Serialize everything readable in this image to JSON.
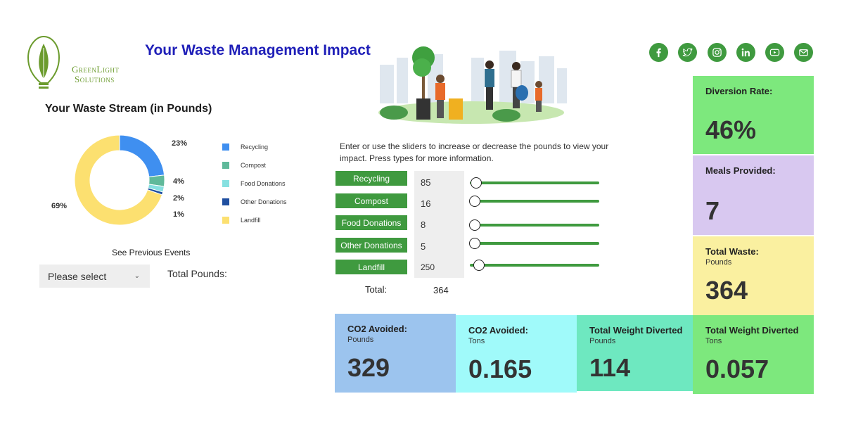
{
  "logo": {
    "line1": "GreenLight",
    "line2": "Solutions"
  },
  "title": "Your Waste Management Impact",
  "chart": {
    "title": "Your Waste Stream (in Pounds)"
  },
  "chart_data": {
    "type": "pie",
    "categories": [
      "Recycling",
      "Compost",
      "Food Donations",
      "Other Donations",
      "Landfill"
    ],
    "values": [
      23,
      4,
      2,
      1,
      69
    ],
    "labels": [
      "23%",
      "4%",
      "2%",
      "1%",
      "69%"
    ],
    "colors": [
      "#3f8ff0",
      "#5fb99a",
      "#86e0e0",
      "#1f4fa0",
      "#fce070"
    ],
    "legend_position": "right"
  },
  "events": {
    "label": "See Previous Events",
    "select_placeholder": "Please select",
    "total_pounds_label": "Total Pounds:"
  },
  "instructions": "Enter or use the sliders to increase or decrease the pounds to view your impact. Press types for more information.",
  "inputs": [
    {
      "label": "Recycling",
      "value": "85",
      "slider_fraction": 0.03
    },
    {
      "label": "Compost",
      "value": "16",
      "slider_fraction": 0.02
    },
    {
      "label": "Food Donations",
      "value": "8",
      "slider_fraction": 0.02
    },
    {
      "label": "Other Donations",
      "value": "5",
      "slider_fraction": 0.02
    },
    {
      "label": "Landfill",
      "value": "250",
      "slider_fraction": 0.05
    }
  ],
  "total": {
    "label": "Total:",
    "value": "364"
  },
  "social": [
    "facebook-icon",
    "twitter-icon",
    "instagram-icon",
    "linkedin-icon",
    "youtube-icon",
    "email-icon"
  ],
  "cards": {
    "diversion": {
      "title": "Diversion Rate:",
      "value": "46%",
      "color": "#7de87d"
    },
    "meals": {
      "title": "Meals Provided:",
      "value": "7",
      "color": "#d8c8f0"
    },
    "total_waste": {
      "title": "Total Waste:",
      "sub": "Pounds",
      "value": "364",
      "color": "#faf0a0"
    },
    "co2_pounds": {
      "title": "CO2 Avoided:",
      "sub": "Pounds",
      "value": "329",
      "color": "#9cc4ee"
    },
    "co2_tons": {
      "title": "CO2 Avoided:",
      "sub": "Tons",
      "value": "0.165",
      "color": "#a0fafa"
    },
    "diverted_pounds": {
      "title": "Total Weight Diverted",
      "sub": "Pounds",
      "value": "114",
      "color": "#6ee8c0"
    },
    "diverted_tons": {
      "title": "Total Weight Diverted",
      "sub": "Tons",
      "value": "0.057",
      "color": "#7de87d"
    }
  }
}
